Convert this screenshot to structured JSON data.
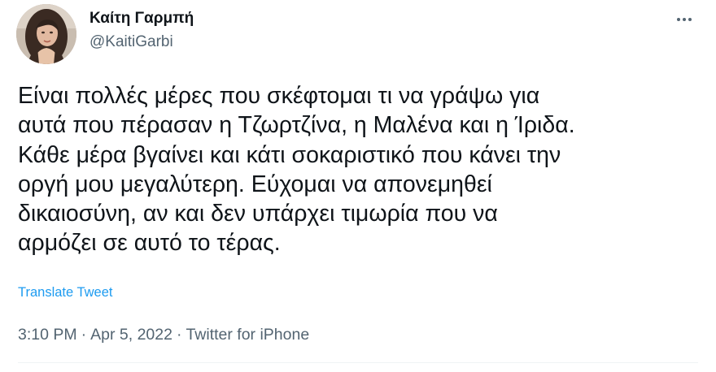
{
  "author": {
    "display_name": "Καίτη Γαρμπή",
    "handle": "@KaitiGarbi"
  },
  "tweet": {
    "lines": [
      "Είναι πολλές μέρες που σκέφτομαι τι να γράψω για",
      "αυτά που πέρασαν η Τζωρτζίνα, η Μαλένα και η Ίριδα.",
      "Κάθε μέρα βγαίνει και κάτι σοκαριστικό που κάνει την",
      "οργή μου μεγαλύτερη. Εύχομαι να απονεμηθεί",
      "δικαιοσύνη, αν και δεν υπάρχει τιμωρία που να",
      "αρμόζει σε αυτό το τέρας."
    ],
    "translate_label": "Translate Tweet",
    "time": "3:10 PM",
    "separator": "·",
    "date": "Apr 5, 2022",
    "source": "Twitter for iPhone"
  },
  "icons": {
    "more": "more-horizontal-icon"
  },
  "colors": {
    "text": "#0f1419",
    "secondary": "#536471",
    "link": "#1d9bf0",
    "divider": "#eff3f4"
  }
}
